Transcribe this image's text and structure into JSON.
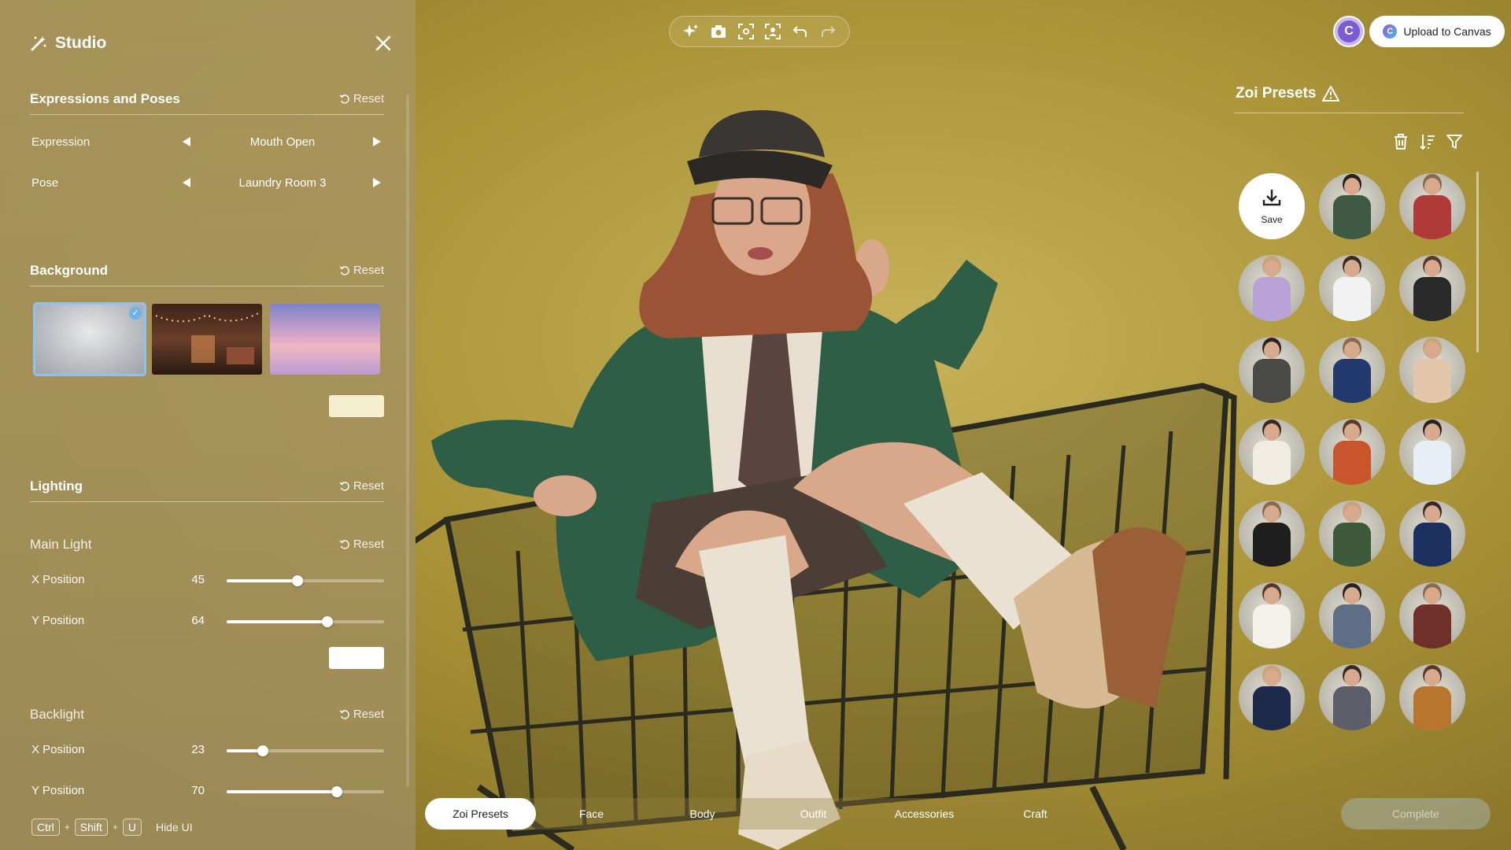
{
  "panel": {
    "title": "Studio",
    "reset_label": "Reset",
    "expressions": {
      "title": "Expressions and Poses",
      "expression_label": "Expression",
      "expression_value": "Mouth Open",
      "pose_label": "Pose",
      "pose_value": "Laundry Room 3"
    },
    "background": {
      "title": "Background",
      "swatch_color": "#f6efcf"
    },
    "lighting": {
      "title": "Lighting",
      "main_light": {
        "title": "Main Light",
        "x_label": "X Position",
        "x_value": 45,
        "y_label": "Y Position",
        "y_value": 64,
        "swatch_color": "#ffffff"
      },
      "backlight": {
        "title": "Backlight",
        "x_label": "X Position",
        "x_value": 23,
        "y_label": "Y Position",
        "y_value": 70
      }
    },
    "hotkeys": {
      "k1": "Ctrl",
      "k2": "Shift",
      "k3": "U",
      "plus": "+",
      "action": "Hide UI"
    }
  },
  "toolbar": {
    "icons": [
      "sparkle-icon",
      "camera-icon",
      "focus-frame-icon",
      "face-capture-icon",
      "undo-icon",
      "redo-icon"
    ]
  },
  "header": {
    "avatar_letter": "C",
    "upload_label": "Upload to Canvas"
  },
  "presets": {
    "title": "Zoi Presets",
    "save_label": "Save",
    "outfit_colors": [
      null,
      "#3f5a44",
      "#b03a3a",
      "#b9a2d8",
      "#f2f2f2",
      "#2a2a2a",
      "#4a4a48",
      "#233a6e",
      "#e2c6aa",
      "#f0ece2",
      "#c9552c",
      "#e8eef5",
      "#1f1f1f",
      "#3d5a3a",
      "#1d3160",
      "#f3f1ea",
      "#5e6e86",
      "#6e3028",
      "#1e2a4a",
      "#5c5f6a",
      "#b8752e"
    ]
  },
  "tabs": [
    "Zoi Presets",
    "Face",
    "Body",
    "Outfit",
    "Accessories",
    "Craft"
  ],
  "active_tab": "Zoi Presets",
  "complete_label": "Complete",
  "accent": "#8fc3ef"
}
